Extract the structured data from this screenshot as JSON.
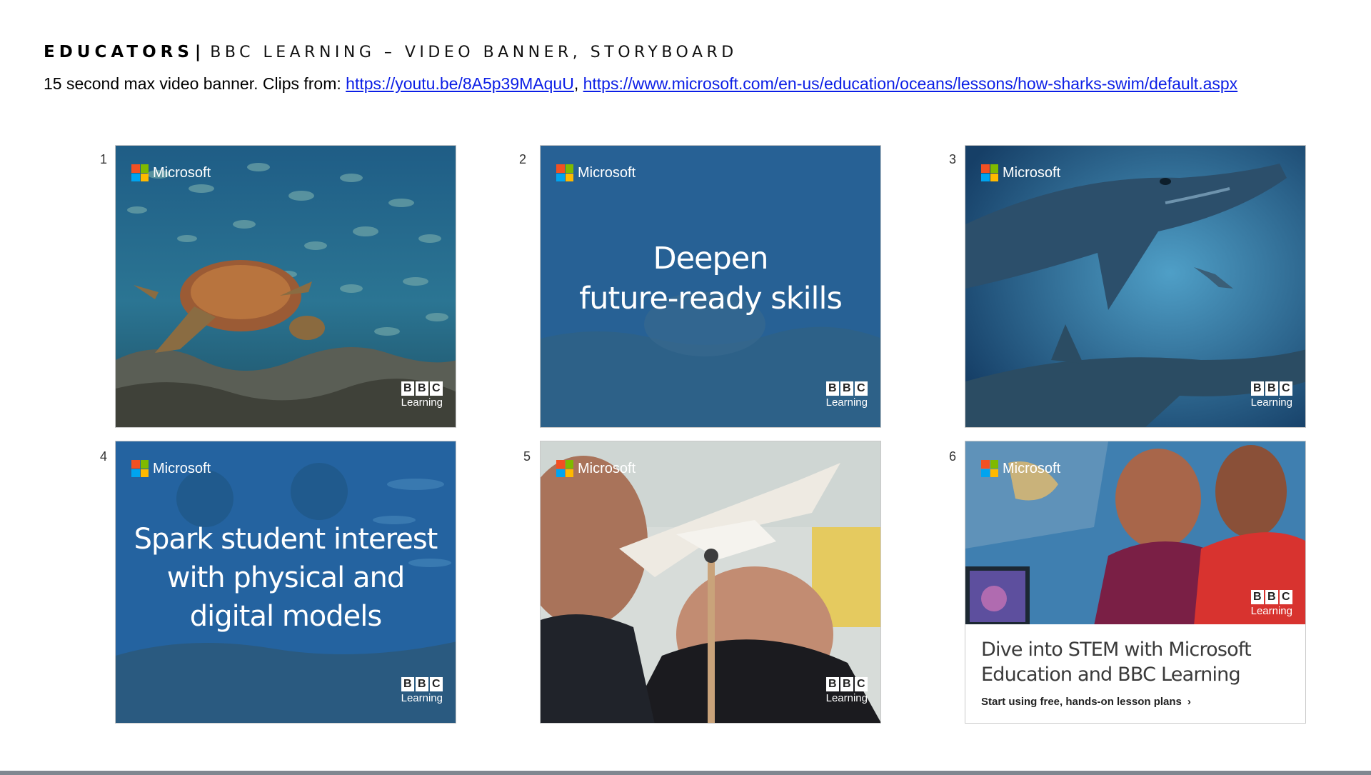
{
  "header": {
    "brand": "EDUCATORS",
    "separator": "|",
    "title": "BBC LEARNING – VIDEO BANNER, STORYBOARD",
    "subtitle_prefix": "15 second max video banner. Clips from: ",
    "link1": "https://youtu.be/8A5p39MAquU",
    "comma": ",",
    "link2": "https://www.microsoft.com/en-us/education/oceans/lessons/how-sharks-swim/default.aspx"
  },
  "logos": {
    "microsoft": "Microsoft",
    "bbc_letters": [
      "B",
      "B",
      "C"
    ],
    "bbc_sub": "Learning"
  },
  "colors": {
    "ms_red": "#f25022",
    "ms_green": "#7fba00",
    "ms_blue": "#00a4ef",
    "ms_yellow": "#ffb900",
    "link": "#0b1ee6"
  },
  "frames": [
    {
      "number": "1",
      "scene": "turtle-reef"
    },
    {
      "number": "2",
      "scene": "turtle-overlay",
      "headline_1": "Deepen",
      "headline_2": "future-ready skills"
    },
    {
      "number": "3",
      "scene": "sharks"
    },
    {
      "number": "4",
      "scene": "underwater-overlay",
      "headline_1": "Spark student interest",
      "headline_2": "with physical and",
      "headline_3": "digital models"
    },
    {
      "number": "5",
      "scene": "students-shark-model"
    },
    {
      "number": "6",
      "scene": "students-tablet",
      "headline_1": "Dive into STEM with Microsoft",
      "headline_2": "Education and BBC Learning",
      "cta": "Start using free, hands-on lesson plans",
      "cta_icon": "chevron-right-icon"
    }
  ]
}
